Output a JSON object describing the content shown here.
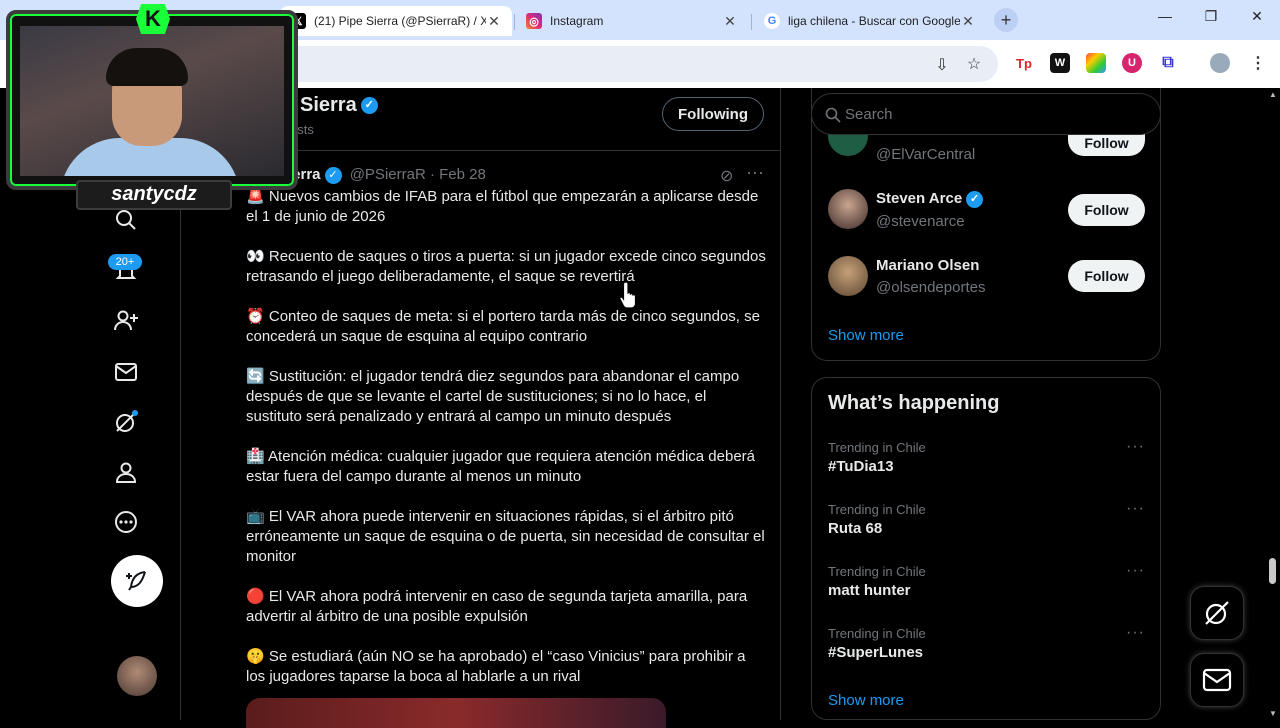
{
  "browser": {
    "tabs": [
      {
        "title": "(21) Pipe Sierra (@PSierraR) / X",
        "favicon": "x-logo",
        "active": true
      },
      {
        "title": "Instagram",
        "favicon": "instagram-logo",
        "active": false
      },
      {
        "title": "liga chilena - Buscar con Google",
        "favicon": "google-logo",
        "active": false
      }
    ],
    "new_tab": "+",
    "controls": {
      "minimize": "—",
      "restore": "❐",
      "close": "✕"
    }
  },
  "webcam": {
    "logo": "K",
    "streamer_name": "santycdz"
  },
  "nav": {
    "notifications_badge": "20+"
  },
  "profile": {
    "name": "Sierra",
    "posts_label": "osts",
    "following_label": "Following"
  },
  "tweet": {
    "author": "ierra",
    "handle": "@PSierraR",
    "separator": "·",
    "date": "Feb 28",
    "paragraphs": [
      "Nuevos cambios de IFAB para el fútbol que empezarán a aplicarse desde el 1 de junio de 2026",
      "Recuento de saques o tiros a puerta: si un jugador excede cinco segundos retrasando el juego deliberadamente, el saque se revertirá",
      "Conteo de saques de meta: si el portero tarda más de cinco segundos, se concederá un saque de esquina al equipo contrario",
      "Sustitución: el jugador tendrá diez segundos para abandonar el campo después de que se levante el cartel de sustituciones; si no lo hace, el sustituto será penalizado y entrará al campo un minuto después",
      "Atención médica: cualquier jugador que requiera atención médica deberá estar fuera del campo durante al menos un minuto",
      "El VAR ahora puede intervenir en situaciones rápidas, si el árbitro pitó erróneamente un saque de esquina o de puerta, sin necesidad de consultar el monitor",
      "El VAR ahora podrá intervenir en caso de segunda tarjeta amarilla, para advertir al árbitro de una posible expulsión",
      "Se estudiará (aún NO se ha aprobado) el “caso Vinicius” para prohibir a los jugadores taparse la boca al hablarle a un rival"
    ],
    "emojis": [
      "🚨",
      "👀",
      "⏰",
      "🔄",
      "🏥",
      "📺",
      "🔴",
      "🤫"
    ]
  },
  "search": {
    "placeholder": "Search"
  },
  "who_to_follow": {
    "partial_handle": "@ElVarCentral",
    "accounts": [
      {
        "name": "Steven Arce",
        "handle": "@stevenarce",
        "verified": true
      },
      {
        "name": "Mariano Olsen",
        "handle": "@olsendeportes",
        "verified": false
      }
    ],
    "follow_label": "Follow",
    "show_more": "Show more"
  },
  "trends": {
    "title": "What’s happening",
    "items": [
      {
        "context": "Trending in Chile",
        "topic": "#TuDia13"
      },
      {
        "context": "Trending in Chile",
        "topic": "Ruta 68"
      },
      {
        "context": "Trending in Chile",
        "topic": "matt hunter"
      },
      {
        "context": "Trending in Chile",
        "topic": "#SuperLunes"
      }
    ],
    "show_more": "Show more"
  },
  "colors": {
    "accent": "#1d9bf0",
    "background": "#000000",
    "border": "#2f3336",
    "webcam_green": "#19ff3a"
  }
}
